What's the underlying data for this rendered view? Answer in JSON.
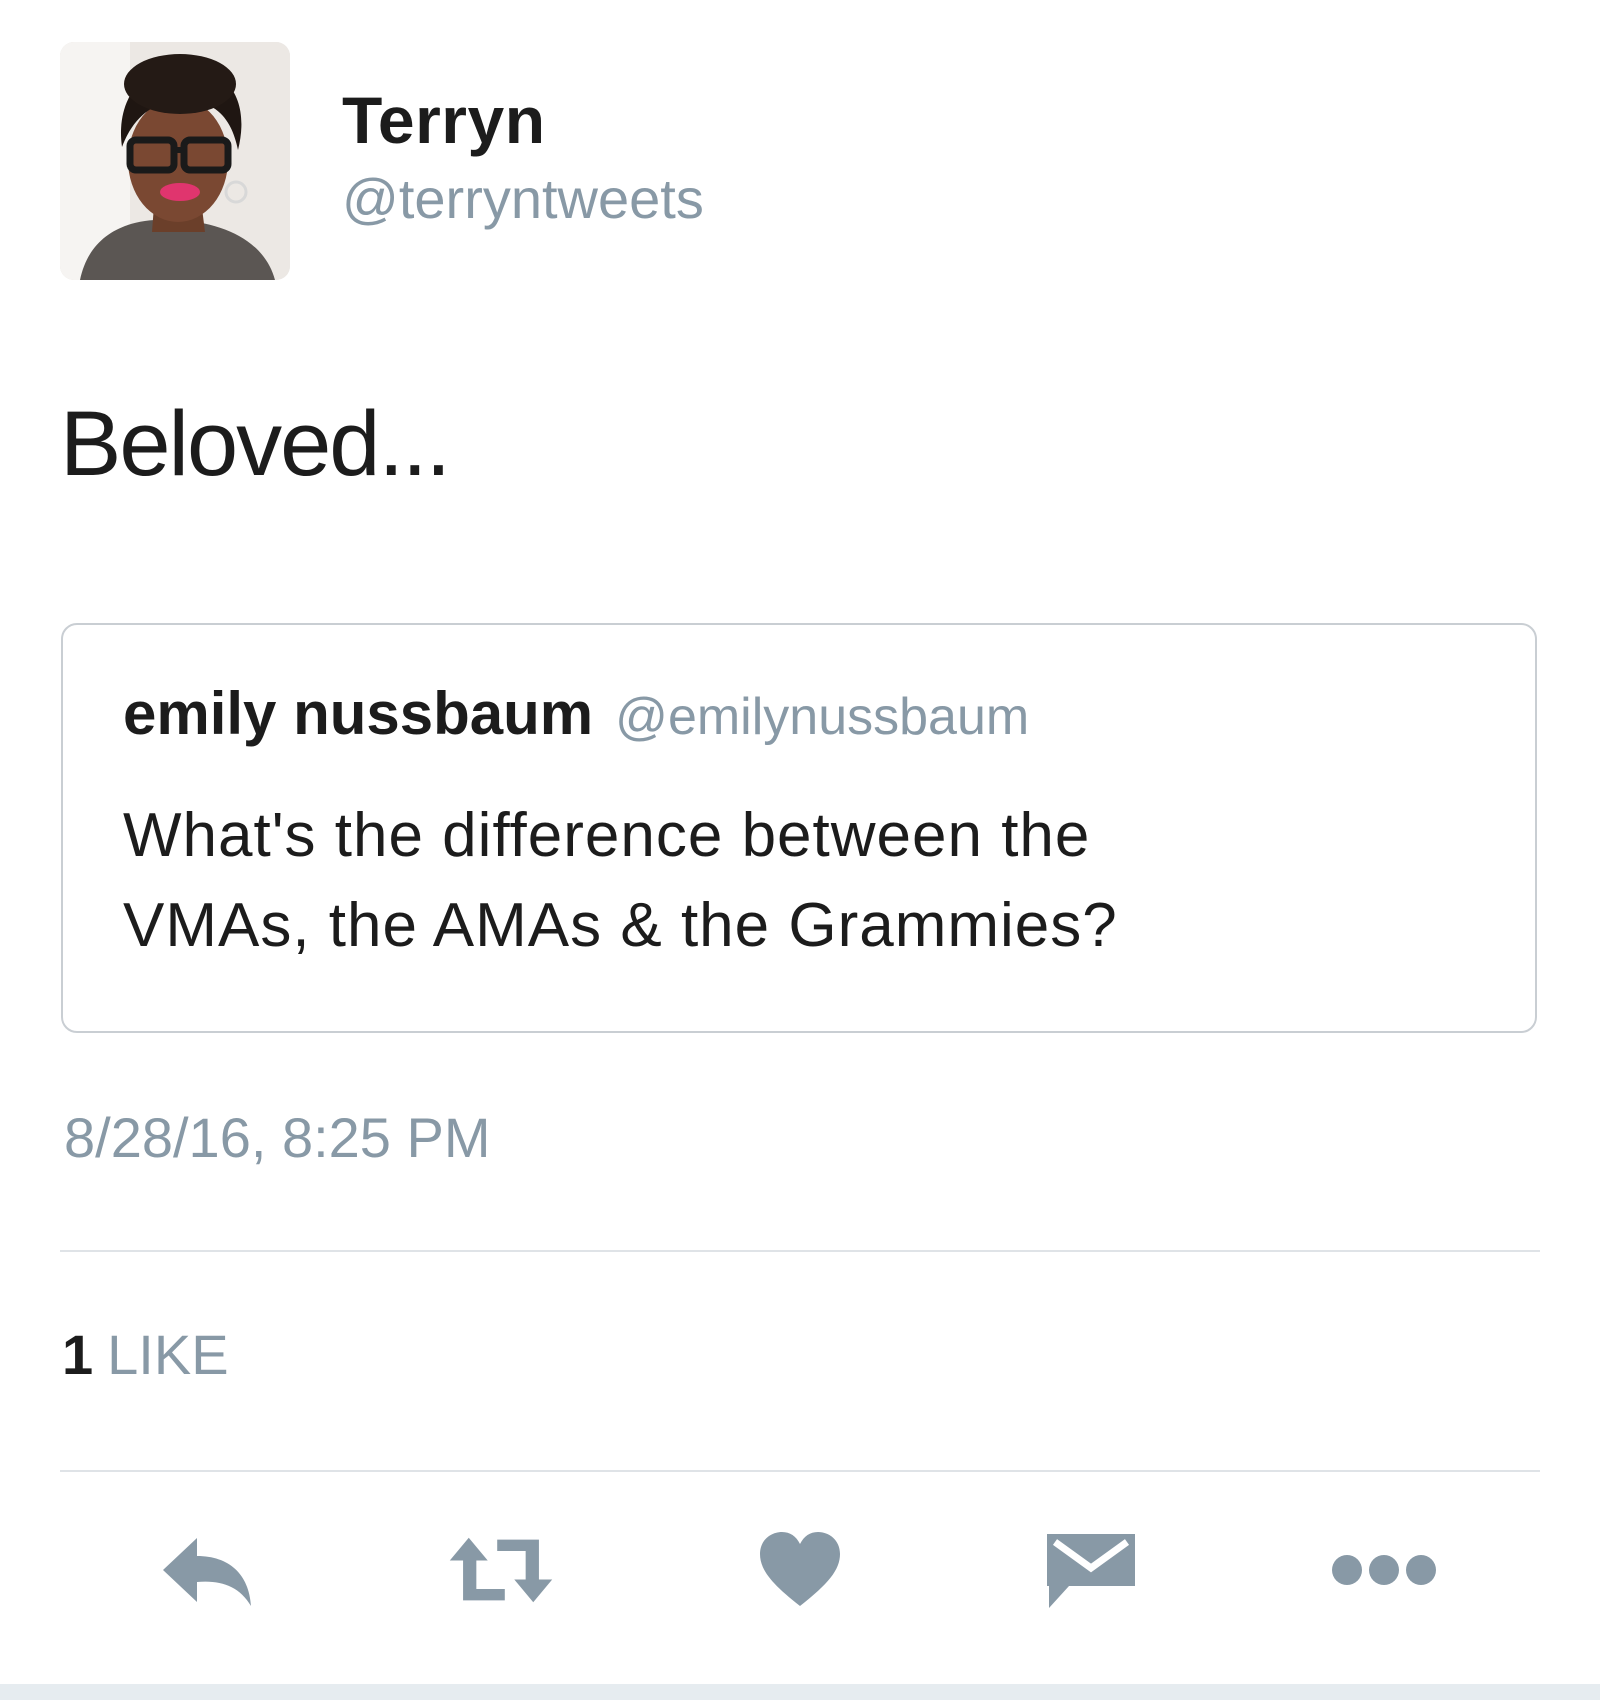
{
  "tweet": {
    "author": {
      "display_name": "Terryn",
      "handle": "@terryntweets"
    },
    "text": "Beloved...",
    "quoted_tweet": {
      "author_name": "emily nussbaum",
      "author_handle": "@emilynussbaum",
      "text_line_1": "What's the difference between the",
      "text_line_2": "VMAs, the AMAs & the Grammies?"
    },
    "timestamp": "8/28/16, 8:25 PM",
    "likes": {
      "count": "1",
      "label": "LIKE"
    }
  },
  "actions": [
    {
      "icon": "reply-icon"
    },
    {
      "icon": "retweet-icon"
    },
    {
      "icon": "heart-icon"
    },
    {
      "icon": "direct-message-icon"
    },
    {
      "icon": "more-options-icon"
    }
  ],
  "colors": {
    "secondary_text": "#8899a6",
    "primary_text": "#1c1c1c",
    "icon": "#8899a6",
    "divider": "#dfe3e7",
    "card_border": "#c9ced3"
  }
}
